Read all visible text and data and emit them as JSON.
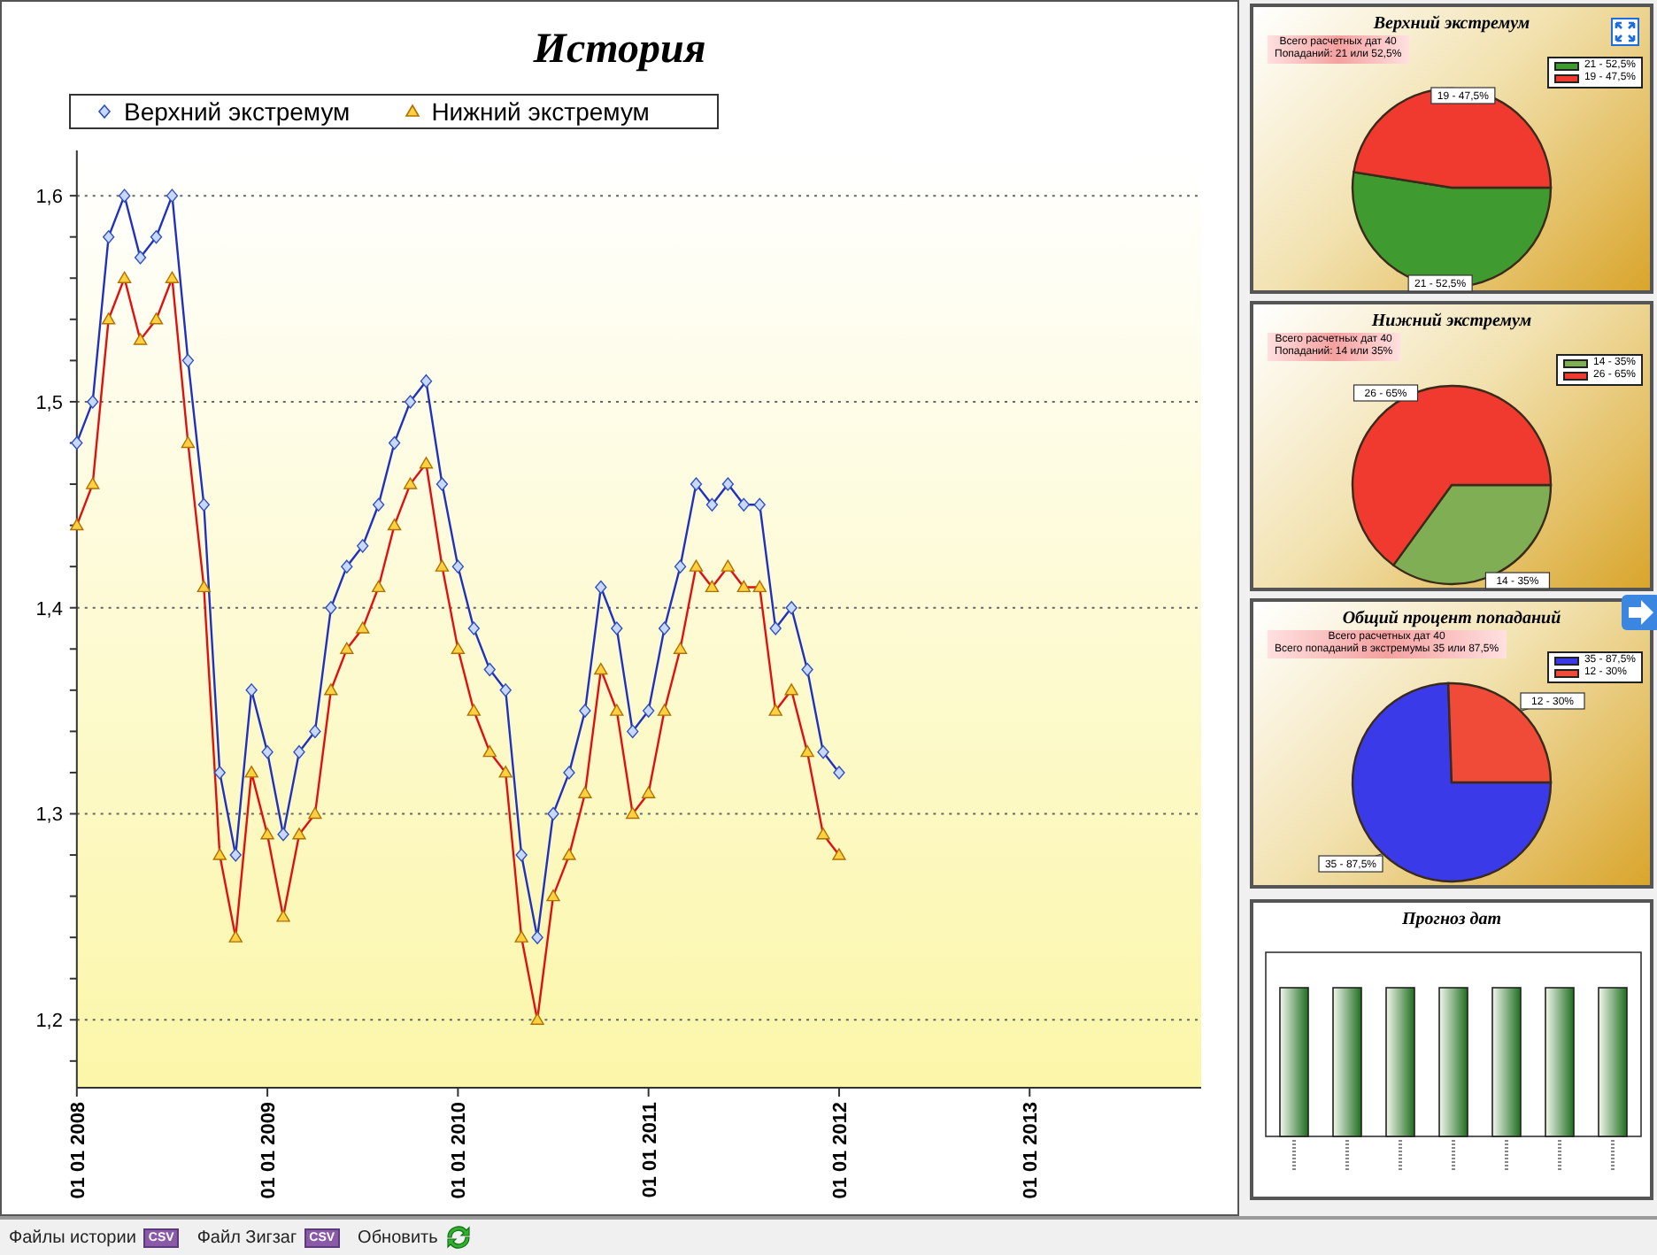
{
  "history": {
    "title": "История",
    "chart_data": {
      "type": "line",
      "grid": true,
      "categories": [
        "01 01 2008",
        null,
        null,
        null,
        null,
        null,
        null,
        null,
        null,
        null,
        null,
        null,
        "01 01 2009",
        null,
        null,
        null,
        null,
        null,
        null,
        null,
        null,
        null,
        null,
        null,
        "01 01 2010",
        null,
        null,
        null,
        null,
        null,
        null,
        null,
        null,
        null,
        null,
        null,
        "01 01 2011",
        null,
        null,
        null,
        null,
        null,
        null,
        null,
        null,
        null,
        null,
        null,
        "01 01 2012",
        null,
        null,
        null,
        null,
        null,
        null,
        null,
        null,
        null,
        null,
        null,
        "01 01 2013"
      ],
      "series": [
        {
          "name": "Верхний экстремум",
          "color": "#2030c0",
          "marker": "diamond",
          "values": [
            1.48,
            1.5,
            1.58,
            1.6,
            1.57,
            1.58,
            1.6,
            1.52,
            1.45,
            1.32,
            1.28,
            1.36,
            1.33,
            1.29,
            1.33,
            1.34,
            1.4,
            1.42,
            1.43,
            1.45,
            1.48,
            1.5,
            1.51,
            1.46,
            1.42,
            1.39,
            1.37,
            1.36,
            1.28,
            1.24,
            1.3,
            1.32,
            1.35,
            1.41,
            1.39,
            1.34,
            1.35,
            1.39,
            1.42,
            1.46,
            1.45,
            1.46,
            1.45,
            1.45,
            1.39,
            1.4,
            1.37,
            1.33,
            1.32,
            null,
            null,
            null,
            null,
            null,
            null,
            null,
            null,
            null,
            null,
            null,
            null
          ]
        },
        {
          "name": "Нижний экстремум",
          "color": "#e01010",
          "marker": "triangle",
          "values": [
            1.44,
            1.46,
            1.54,
            1.56,
            1.53,
            1.54,
            1.56,
            1.48,
            1.41,
            1.28,
            1.24,
            1.32,
            1.29,
            1.25,
            1.29,
            1.3,
            1.36,
            1.38,
            1.39,
            1.41,
            1.44,
            1.46,
            1.47,
            1.42,
            1.38,
            1.35,
            1.33,
            1.32,
            1.24,
            1.2,
            1.26,
            1.28,
            1.31,
            1.37,
            1.35,
            1.3,
            1.31,
            1.35,
            1.38,
            1.42,
            1.41,
            1.42,
            1.41,
            1.41,
            1.35,
            1.36,
            1.33,
            1.29,
            1.28,
            null,
            null,
            null,
            null,
            null,
            null,
            null,
            null,
            null,
            null,
            null,
            null
          ]
        }
      ],
      "ylim": [
        1.167,
        1.622
      ],
      "yticks": [
        {
          "value": 1.2,
          "label": "1,2"
        },
        {
          "value": 1.3,
          "label": "1,3"
        },
        {
          "value": 1.4,
          "label": "1,4"
        },
        {
          "value": 1.5,
          "label": "1,5"
        },
        {
          "value": 1.6,
          "label": "1,6"
        }
      ]
    }
  },
  "panels": [
    {
      "kind": "pie",
      "title": "Верхний экстремум",
      "summary": [
        "Всего расчетных дат 40",
        "Попаданий: 21 или 52,5%"
      ],
      "legend": [
        {
          "label": "21 - 52,5%",
          "color": "#3f9a30"
        },
        {
          "label": "19 - 47,5%",
          "color": "#f03a30"
        }
      ],
      "chart_data": {
        "type": "pie",
        "categories": [
          "21 - 52,5%",
          "19 - 47,5%"
        ],
        "values": [
          21,
          19
        ]
      }
    },
    {
      "kind": "pie",
      "title": "Нижний экстремум",
      "summary": [
        "Всего расчетных дат 40",
        "Попаданий: 14 или 35%"
      ],
      "legend": [
        {
          "label": "14 - 35%",
          "color": "#7fae55"
        },
        {
          "label": "26 - 65%",
          "color": "#f03a30"
        }
      ],
      "chart_data": {
        "type": "pie",
        "categories": [
          "14 - 35%",
          "26 - 65%"
        ],
        "values": [
          14,
          26
        ]
      }
    },
    {
      "kind": "pie",
      "title": "Общий процент попаданий",
      "summary": [
        "Всего расчетных дат 40",
        "Всего попаданий в экстремумы 35 или 87,5%"
      ],
      "legend": [
        {
          "label": "35 - 87,5%",
          "color": "#3a3ae8"
        },
        {
          "label": "12 - 30%",
          "color": "#f04a38"
        }
      ],
      "chart_data": {
        "type": "pie",
        "categories": [
          "35 - 87,5%",
          "12 - 30%"
        ],
        "values": [
          35,
          12
        ]
      }
    },
    {
      "kind": "bars",
      "title": "Прогноз дат"
    }
  ],
  "toolbar": [
    {
      "label": "Файлы истории",
      "kind": "csv",
      "badge": "CSV"
    },
    {
      "label": "Файл Зигзаг",
      "kind": "csv",
      "badge": "CSV"
    },
    {
      "label": "Обновить",
      "kind": "refresh"
    }
  ]
}
